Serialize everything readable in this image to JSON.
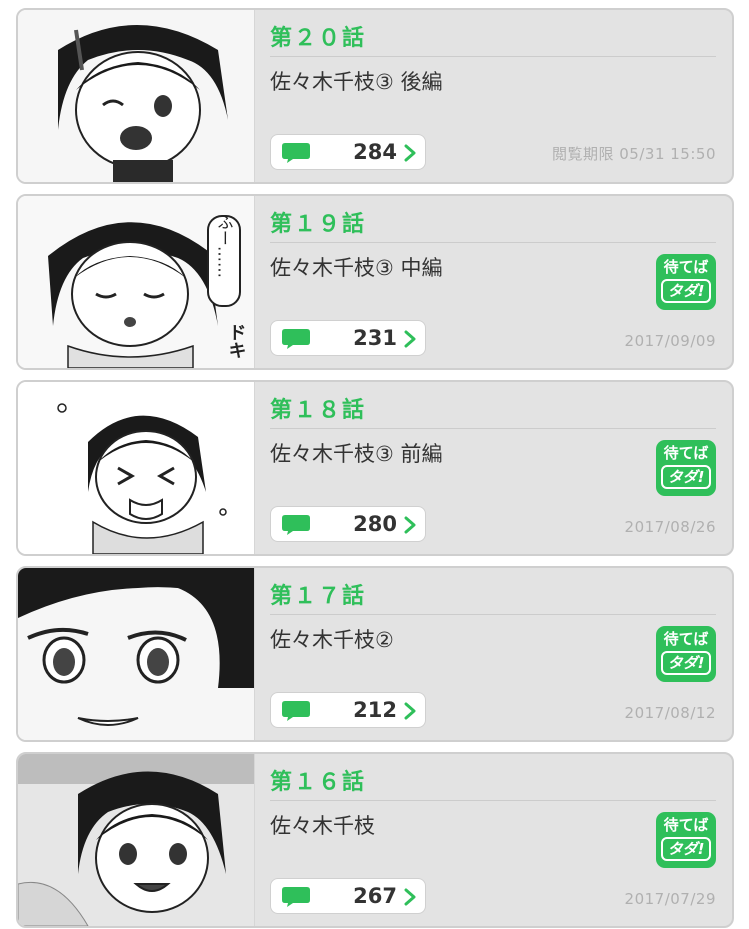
{
  "episodes": [
    {
      "title": "第２０話",
      "subtitle": "佐々木千枝③ 後編",
      "comments": "284",
      "date": "閲覧期限 05/31 15:50",
      "free_badge": null
    },
    {
      "title": "第１９話",
      "subtitle": "佐々木千枝③ 中編",
      "comments": "231",
      "date": "2017/09/09",
      "free_badge": {
        "line1": "待てば",
        "line2": "タダ!"
      }
    },
    {
      "title": "第１８話",
      "subtitle": "佐々木千枝③ 前編",
      "comments": "280",
      "date": "2017/08/26",
      "free_badge": {
        "line1": "待てば",
        "line2": "タダ!"
      }
    },
    {
      "title": "第１７話",
      "subtitle": "佐々木千枝②",
      "comments": "212",
      "date": "2017/08/12",
      "free_badge": {
        "line1": "待てば",
        "line2": "タダ!"
      }
    },
    {
      "title": "第１６話",
      "subtitle": "佐々木千枝",
      "comments": "267",
      "date": "2017/07/29",
      "free_badge": {
        "line1": "待てば",
        "line2": "タダ!"
      }
    }
  ],
  "icons": {
    "comment": "speech-bubble-icon",
    "chevron": "chevron-right-icon"
  },
  "colors": {
    "accent": "#2fbf5a",
    "card_bg": "#e3e3e3",
    "date_text": "#b0b0b0"
  },
  "thumbnail_sfx": {
    "ep19_bubble": "ふー……",
    "ep19_sfx": "ドキ"
  }
}
